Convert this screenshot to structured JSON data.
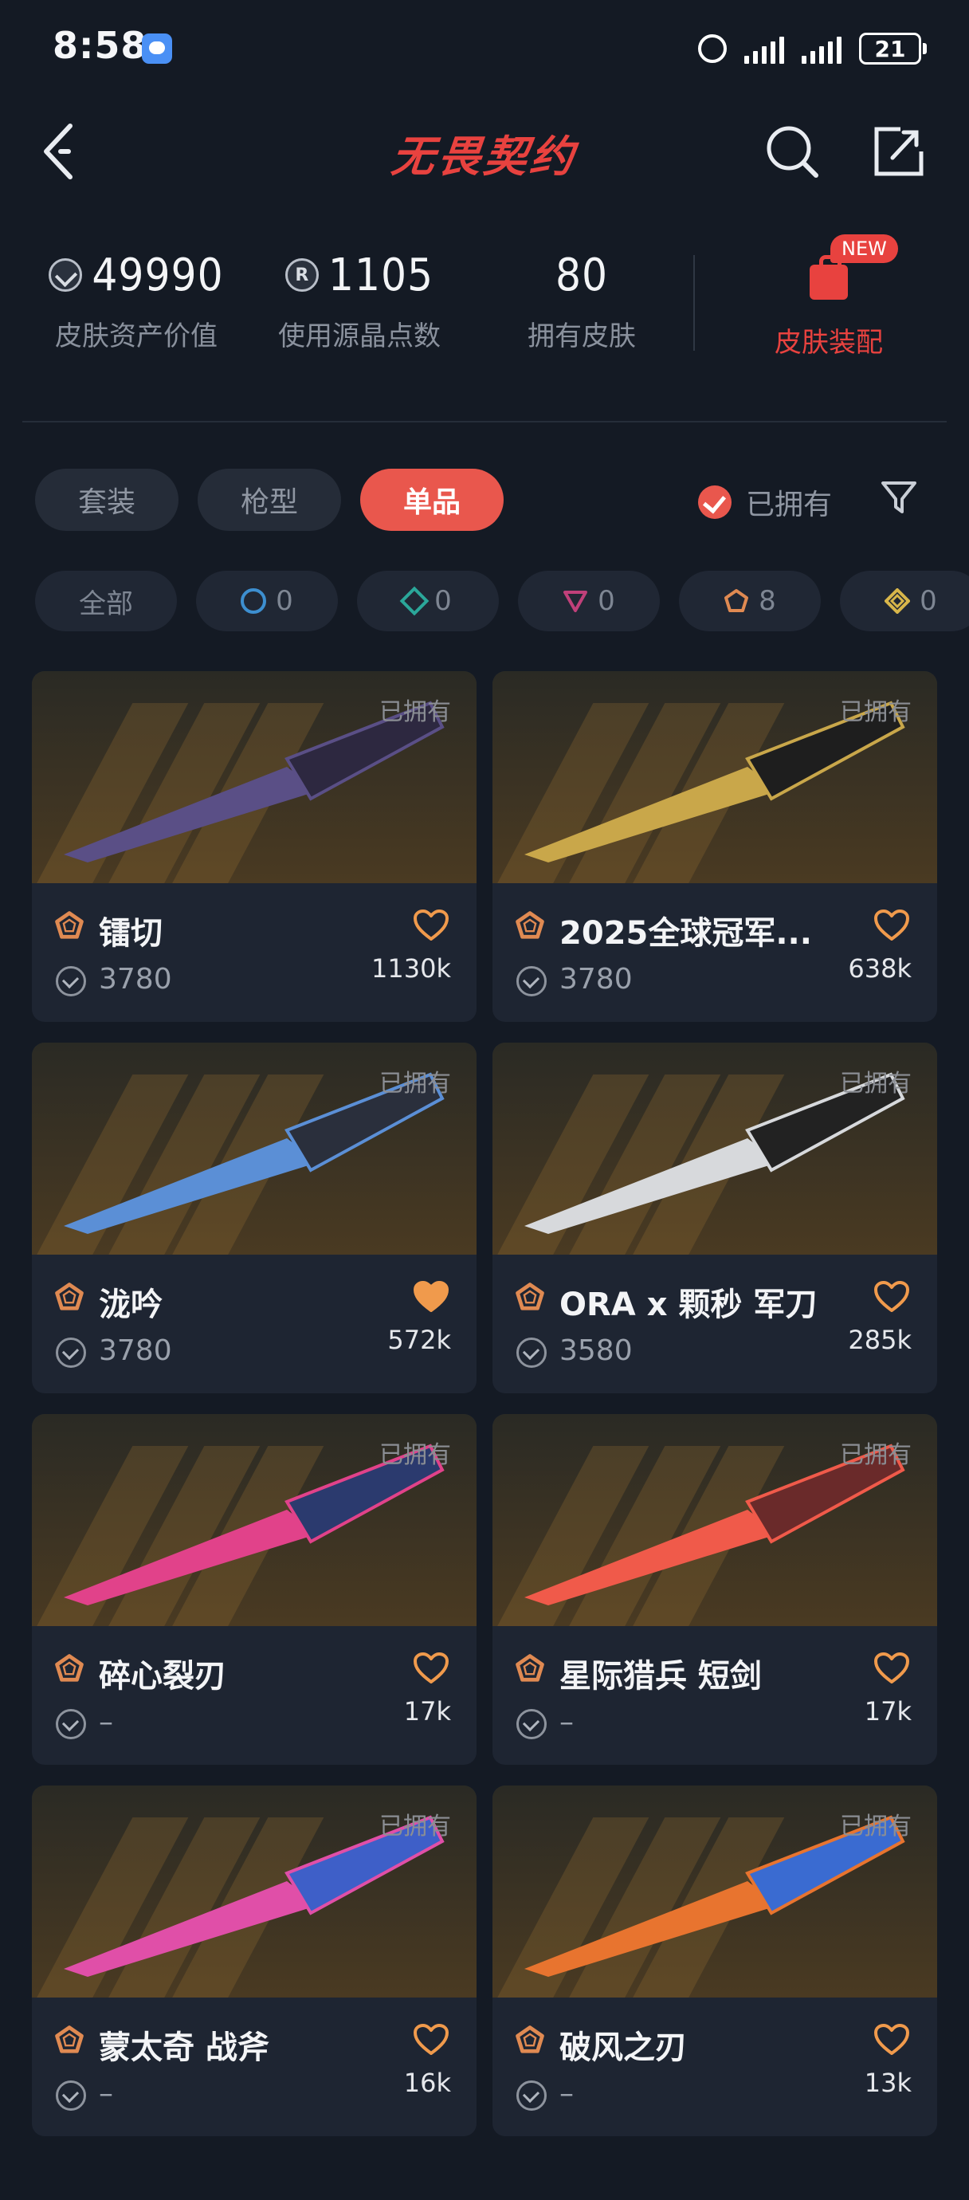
{
  "status": {
    "time": "8:58",
    "battery": "21"
  },
  "header": {
    "title": "无畏契约"
  },
  "stats": [
    {
      "value": "49990",
      "label": "皮肤资产价值",
      "icon": "vp-icon"
    },
    {
      "value": "1105",
      "label": "使用源晶点数",
      "icon": "radianite-icon"
    },
    {
      "value": "80",
      "label": "拥有皮肤"
    }
  ],
  "outfit": {
    "label": "皮肤装配",
    "badge": "NEW"
  },
  "tabs": [
    "套装",
    "枪型",
    "单品"
  ],
  "owned_filter": {
    "label": "已拥有",
    "checked": true
  },
  "chips": [
    {
      "label": "全部"
    },
    {
      "count": "0",
      "tier": "select"
    },
    {
      "count": "0",
      "tier": "deluxe"
    },
    {
      "count": "0",
      "tier": "premium"
    },
    {
      "count": "8",
      "tier": "exclusive"
    },
    {
      "count": "0",
      "tier": "ultra"
    }
  ],
  "owned_label": "已拥有",
  "items": [
    {
      "name": "镭切",
      "price": "3780",
      "likes": "1130k",
      "liked": false
    },
    {
      "name": "2025全球冠军...",
      "price": "3780",
      "likes": "638k",
      "liked": false
    },
    {
      "name": "泷吟",
      "price": "3780",
      "likes": "572k",
      "liked": true
    },
    {
      "name": "ORA x 颗秒 军刀",
      "price": "3580",
      "likes": "285k",
      "liked": false
    },
    {
      "name": "碎心裂刃",
      "price": "–",
      "likes": "17k",
      "liked": false
    },
    {
      "name": "星际猎兵 短剑",
      "price": "–",
      "likes": "17k",
      "liked": false
    },
    {
      "name": "蒙太奇 战斧",
      "price": "–",
      "likes": "16k",
      "liked": false
    },
    {
      "name": "破风之刃",
      "price": "–",
      "likes": "13k",
      "liked": false
    }
  ],
  "colors": {
    "accent": "#e9574d",
    "tier_exclusive": "#e08a52",
    "background": "#141a24"
  }
}
